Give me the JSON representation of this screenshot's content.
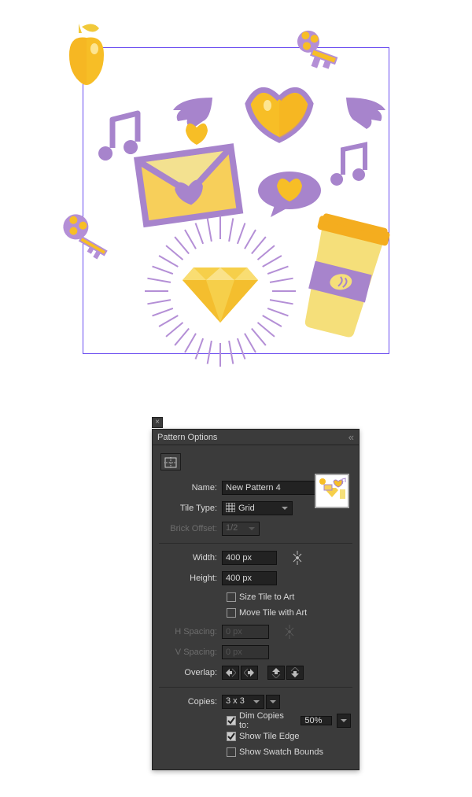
{
  "panel": {
    "title": "Pattern Options",
    "name": {
      "label": "Name:",
      "value": "New Pattern 4"
    },
    "tileType": {
      "label": "Tile Type:",
      "value": "Grid"
    },
    "brickOffset": {
      "label": "Brick Offset:",
      "value": "1/2"
    },
    "width": {
      "label": "Width:",
      "value": "400 px"
    },
    "height": {
      "label": "Height:",
      "value": "400 px"
    },
    "sizeTileToArt": {
      "label": "Size Tile to Art",
      "checked": false
    },
    "moveTileWithArt": {
      "label": "Move Tile with Art",
      "checked": false
    },
    "hSpacing": {
      "label": "H Spacing:",
      "value": "0 px"
    },
    "vSpacing": {
      "label": "V Spacing:",
      "value": "0 px"
    },
    "overlap": {
      "label": "Overlap:"
    },
    "copies": {
      "label": "Copies:",
      "value": "3 x 3"
    },
    "dimCopies": {
      "label": "Dim Copies to:",
      "checked": true,
      "value": "50%"
    },
    "showTileEdge": {
      "label": "Show Tile Edge",
      "checked": true
    },
    "showSwatchBounds": {
      "label": "Show Swatch Bounds",
      "checked": false
    }
  }
}
